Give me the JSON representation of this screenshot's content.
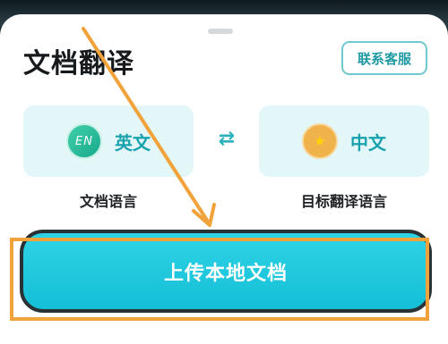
{
  "title": "文档翻译",
  "contact_button": "联系客服",
  "source_language": {
    "badge": "EN",
    "name": "英文",
    "caption": "文档语言"
  },
  "swap_icon": "swap-arrows",
  "target_language": {
    "badge": "★",
    "name": "中文",
    "caption": "目标翻译语言"
  },
  "upload_button": "上传本地文档",
  "watermark": "",
  "colors": {
    "accent": "#17a2ad",
    "button": "#1fc6db",
    "highlight": "#f2a23a",
    "card": "#e3f6f8"
  }
}
